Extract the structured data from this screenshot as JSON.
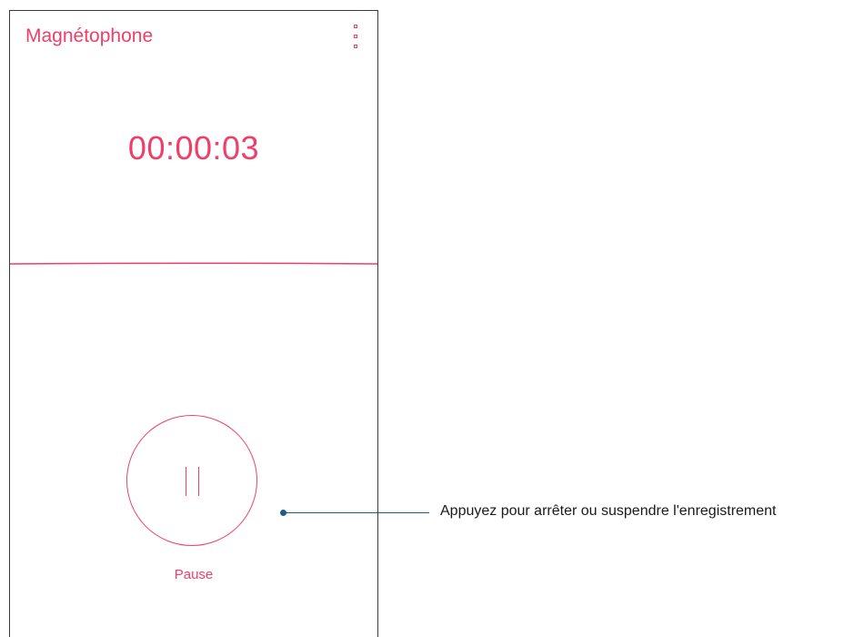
{
  "app": {
    "title": "Magnétophone"
  },
  "recorder": {
    "elapsed_time": "00:00:03",
    "pause_label": "Pause"
  },
  "annotation": {
    "text": "Appuyez pour arrêter ou suspendre l'enregistrement"
  },
  "colors": {
    "accent": "#ee3f6a",
    "callout": "#1e5a85"
  },
  "icons": {
    "menu": "more-vert-icon",
    "pause": "pause-icon"
  }
}
